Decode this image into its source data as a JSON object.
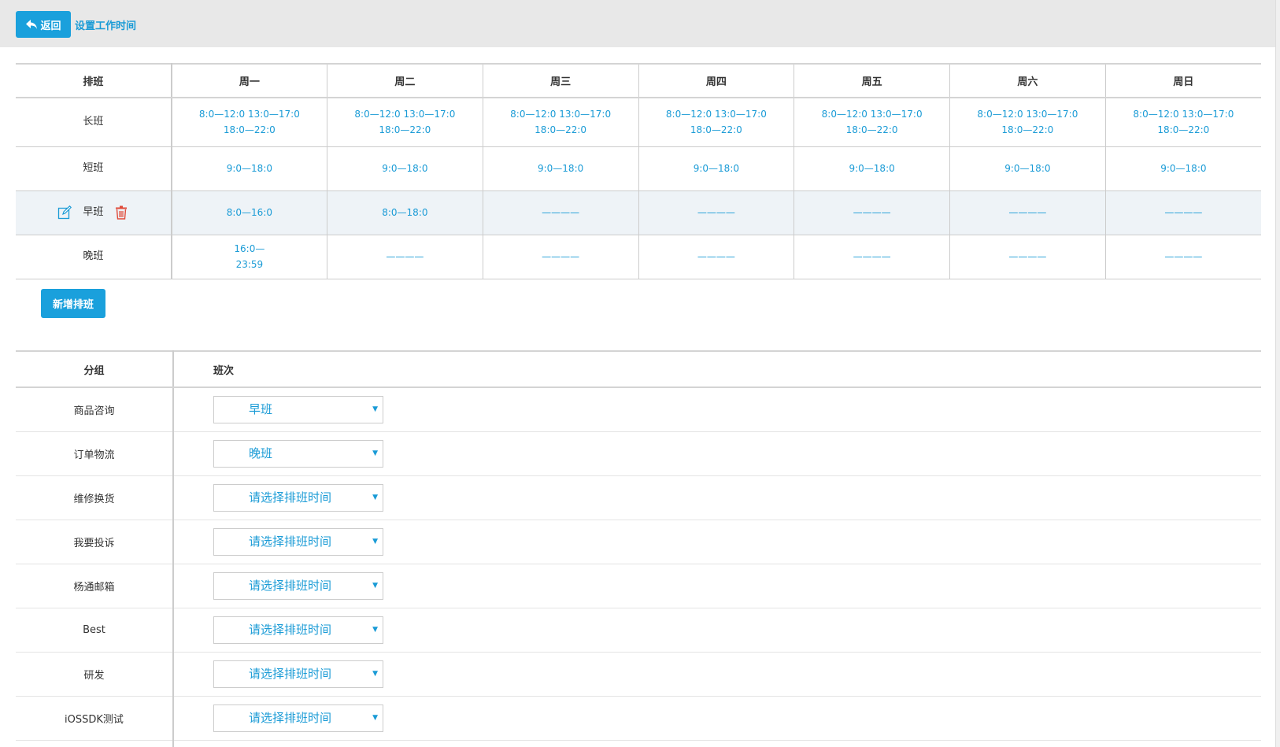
{
  "header": {
    "back_label": "返回",
    "title": "设置工作时间"
  },
  "schedule": {
    "columns": [
      "排班",
      "周一",
      "周二",
      "周三",
      "周四",
      "周五",
      "周六",
      "周日"
    ],
    "rows": [
      {
        "name": "长班",
        "cells": [
          [
            "8:0—12:0  13:0—17:0",
            "18:0—22:0"
          ],
          [
            "8:0—12:0  13:0—17:0",
            "18:0—22:0"
          ],
          [
            "8:0—12:0  13:0—17:0",
            "18:0—22:0"
          ],
          [
            "8:0—12:0  13:0—17:0",
            "18:0—22:0"
          ],
          [
            "8:0—12:0  13:0—17:0",
            "18:0—22:0"
          ],
          [
            "8:0—12:0  13:0—17:0",
            "18:0—22:0"
          ],
          [
            "8:0—12:0  13:0—17:0",
            "18:0—22:0"
          ]
        ]
      },
      {
        "name": "短班",
        "cells": [
          [
            "9:0—18:0"
          ],
          [
            "9:0—18:0"
          ],
          [
            "9:0—18:0"
          ],
          [
            "9:0—18:0"
          ],
          [
            "9:0—18:0"
          ],
          [
            "9:0—18:0"
          ],
          [
            "9:0—18:0"
          ]
        ]
      },
      {
        "name": "早班",
        "cells": [
          [
            "8:0—16:0"
          ],
          [
            "8:0—18:0"
          ],
          [
            "————"
          ],
          [
            "————"
          ],
          [
            "————"
          ],
          [
            "————"
          ],
          [
            "————"
          ]
        ]
      },
      {
        "name": "晚班",
        "cells": [
          [
            "16:0—",
            "23:59"
          ],
          [
            "————"
          ],
          [
            "————"
          ],
          [
            "————"
          ],
          [
            "————"
          ],
          [
            "————"
          ],
          [
            "————"
          ]
        ]
      }
    ]
  },
  "add_shift_label": "新增排班",
  "groups": {
    "columns": [
      "分组",
      "班次"
    ],
    "rows": [
      {
        "name": "商品咨询",
        "shift": "早班"
      },
      {
        "name": "订单物流",
        "shift": "晚班"
      },
      {
        "name": "维修换货",
        "shift": "请选择排班时间"
      },
      {
        "name": "我要投诉",
        "shift": "请选择排班时间"
      },
      {
        "name": "杨通邮箱",
        "shift": "请选择排班时间"
      },
      {
        "name": "Best",
        "shift": "请选择排班时间"
      },
      {
        "name": "研发",
        "shift": "请选择排班时间"
      },
      {
        "name": "iOSSDK测试",
        "shift": "请选择排班时间"
      }
    ]
  },
  "colors": {
    "accent": "#1aa0dc",
    "link": "#1a9bd6",
    "delete": "#e04a3a",
    "highlight_row": "#eef3f7"
  },
  "icons": {
    "back": "back-arrow-icon",
    "edit": "edit-icon",
    "delete": "trash-icon",
    "dropdown": "caret-down-icon"
  }
}
